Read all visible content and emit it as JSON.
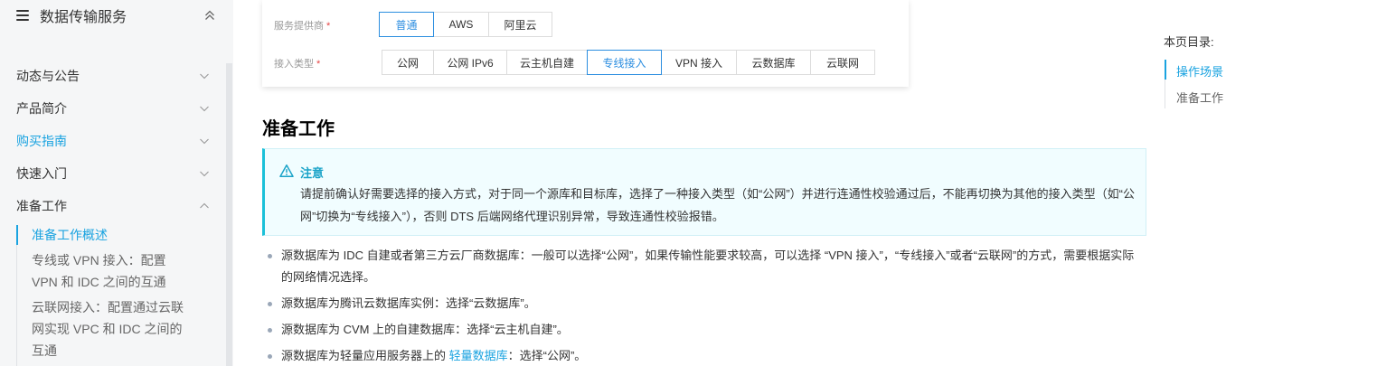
{
  "sidebar": {
    "title": "数据传输服务",
    "items": [
      {
        "label": "动态与公告"
      },
      {
        "label": "产品简介"
      },
      {
        "label": "购买指南"
      },
      {
        "label": "快速入门"
      },
      {
        "label": "准备工作"
      }
    ],
    "sub_items": [
      {
        "label": "准备工作概述"
      },
      {
        "label": "专线或 VPN 接入：配置 VPN 和 IDC 之间的互通"
      },
      {
        "label": "云联网接入：配置通过云联网实现 VPC 和 IDC 之间的互通"
      }
    ]
  },
  "selector": {
    "provider_label": "服务提供商",
    "required_mark": "*",
    "providers": [
      "普通",
      "AWS",
      "阿里云"
    ],
    "provider_selected": "普通",
    "access_label": "接入类型",
    "access_types": [
      "公网",
      "公网 IPv6",
      "云主机自建",
      "专线接入",
      "VPN 接入",
      "云数据库",
      "云联网"
    ],
    "access_selected": "专线接入"
  },
  "section": {
    "title": "准备工作"
  },
  "notice": {
    "title": "注意",
    "body": "请提前确认好需要选择的接入方式，对于同一个源库和目标库，选择了一种接入类型（如“公网”）并进行连通性校验通过后，不能再切换为其他的接入类型（如“公网”切换为“专线接入”），否则 DTS 后端网络代理识别异常，导致连通性校验报错。"
  },
  "bullets": [
    {
      "text": "源数据库为 IDC 自建或者第三方云厂商数据库：一般可以选择“公网”，如果传输性能要求较高，可以选择 “VPN 接入”，“专线接入”或者“云联网”的方式，需要根据实际的网络情况选择。"
    },
    {
      "text": "源数据库为腾讯云数据库实例：选择“云数据库”。"
    },
    {
      "text": "源数据库为 CVM 上的自建数据库：选择“云主机自建”。"
    },
    {
      "text_before": "源数据库为轻量应用服务器上的 ",
      "link": "轻量数据库",
      "text_after": "：选择“公网”。"
    }
  ],
  "toc": {
    "title": "本页目录:",
    "items": [
      {
        "label": "操作场景"
      },
      {
        "label": "准备工作"
      }
    ]
  },
  "colors": {
    "accent": "#1aa3e0",
    "selected_border": "#2c8ee0",
    "notice_bg": "#f1fdff",
    "notice_border": "#1bc0d8",
    "required": "#e54545"
  }
}
